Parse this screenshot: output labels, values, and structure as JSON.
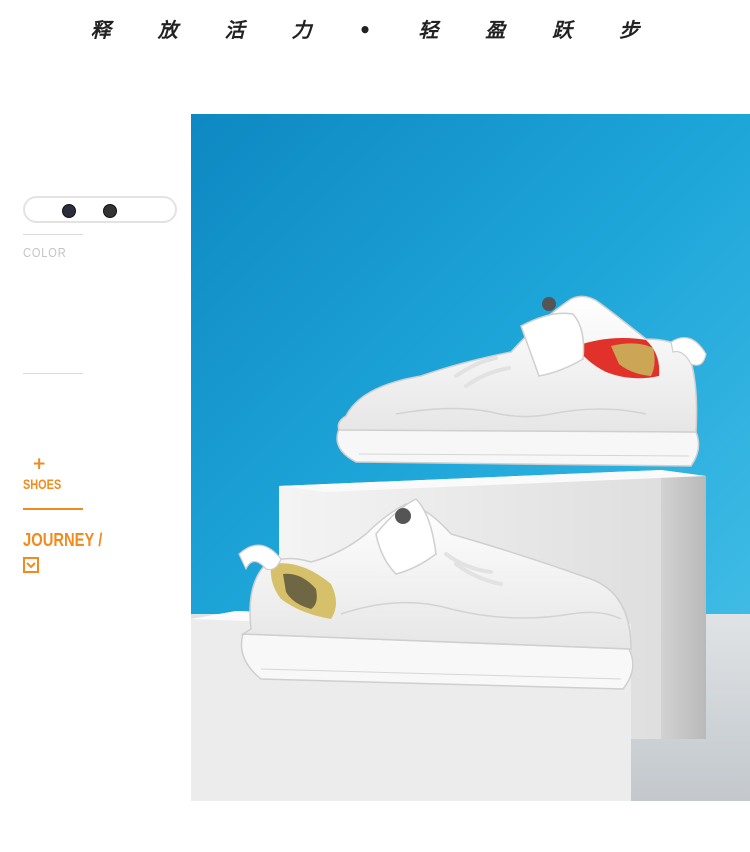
{
  "headline": "释 放 活 力 • 轻 盈 跃 步",
  "sidebar": {
    "swatches": [
      {
        "name": "navy",
        "color": "#2b2e3a"
      },
      {
        "name": "black",
        "color": "#333333"
      }
    ],
    "color_label": "COLOR",
    "plus_symbol": "+",
    "shoes_label": "SHOES",
    "journey_label": "JOURNEY /"
  },
  "colors": {
    "accent": "#f28b1e",
    "backdrop": "#1a9ed4",
    "heel_red": "#e0322a"
  },
  "photo": {
    "subject": "white-sneakers-on-display-blocks"
  }
}
